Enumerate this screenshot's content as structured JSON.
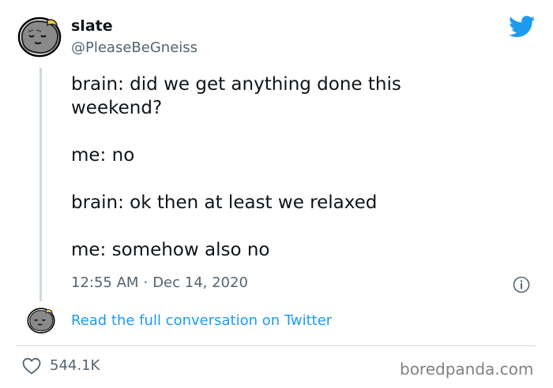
{
  "author": {
    "name": "slate",
    "handle": "@PleaseBeGneiss",
    "avatar_icon": "rock-avatar-icon"
  },
  "tweet": {
    "paragraphs": [
      "brain: did we get anything done this\nweekend?",
      "me: no",
      "brain: ok then at least we relaxed",
      "me: somehow also no"
    ],
    "time": "12:55 AM",
    "separator": "·",
    "date": "Dec 14, 2020"
  },
  "conversation_link": "Read the full conversation on Twitter",
  "likes": "544.1K",
  "watermark": "boredpanda.com",
  "colors": {
    "twitter_blue": "#1d9bf0",
    "text": "#0f1419",
    "muted": "#536471",
    "divider": "#cfd9de"
  }
}
